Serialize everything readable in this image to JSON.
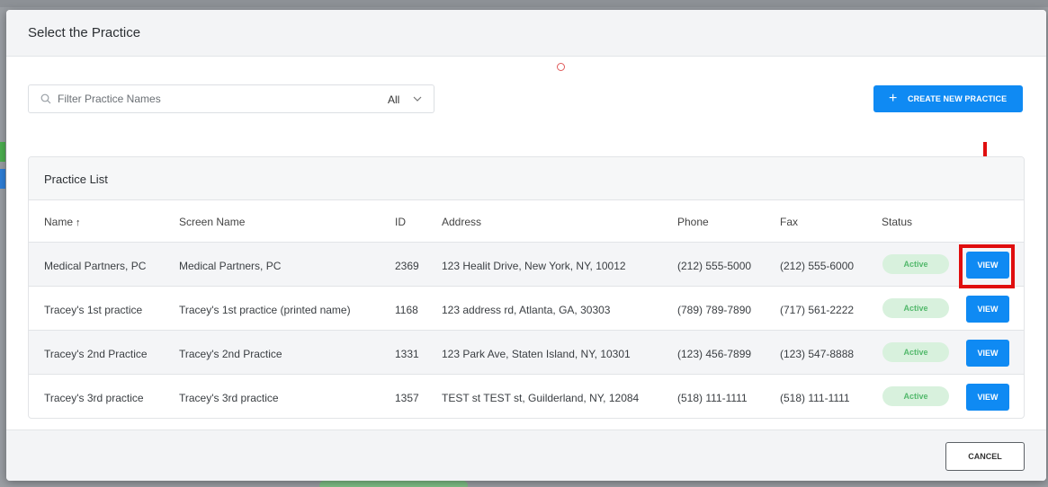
{
  "modal": {
    "title": "Select the Practice"
  },
  "search": {
    "placeholder": "Filter Practice Names",
    "filter_value": "All"
  },
  "toolbar": {
    "create_label": "CREATE NEW PRACTICE"
  },
  "panel": {
    "title": "Practice List"
  },
  "table": {
    "columns": {
      "name": "Name",
      "screen_name": "Screen Name",
      "id": "ID",
      "address": "Address",
      "phone": "Phone",
      "fax": "Fax",
      "status": "Status"
    },
    "sort_indicator": "↑",
    "rows": [
      {
        "name": "Medical Partners, PC",
        "screen_name": "Medical Partners, PC",
        "id": "2369",
        "address": "123 Healit Drive, New York, NY, 10012",
        "phone": "(212) 555-5000",
        "fax": "(212) 555-6000",
        "status": "Active",
        "action": "VIEW"
      },
      {
        "name": "Tracey's 1st practice",
        "screen_name": "Tracey's 1st practice (printed name)",
        "id": "1168",
        "address": "123 address rd, Atlanta, GA, 30303",
        "phone": "(789) 789-7890",
        "fax": "(717) 561-2222",
        "status": "Active",
        "action": "VIEW"
      },
      {
        "name": "Tracey's 2nd Practice",
        "screen_name": "Tracey's 2nd Practice",
        "id": "1331",
        "address": "123 Park Ave, Staten Island, NY, 10301",
        "phone": "(123) 456-7899",
        "fax": "(123) 547-8888",
        "status": "Active",
        "action": "VIEW"
      },
      {
        "name": "Tracey's 3rd practice",
        "screen_name": "Tracey's 3rd practice",
        "id": "1357",
        "address": "TEST st TEST st, Guilderland, NY, 12084",
        "phone": "(518) 111-1111",
        "fax": "(518) 111-1111",
        "status": "Active",
        "action": "VIEW"
      }
    ]
  },
  "footer": {
    "cancel_label": "CANCEL"
  },
  "colors": {
    "primary": "#0f8af3",
    "status_bg": "#d8f1dd",
    "status_text": "#53b96c",
    "annotation": "#e00e0e"
  },
  "icons": {
    "search": "search-icon",
    "chevron": "chevron-down-icon",
    "plus": "plus-icon",
    "sort": "arrow-up-icon"
  }
}
